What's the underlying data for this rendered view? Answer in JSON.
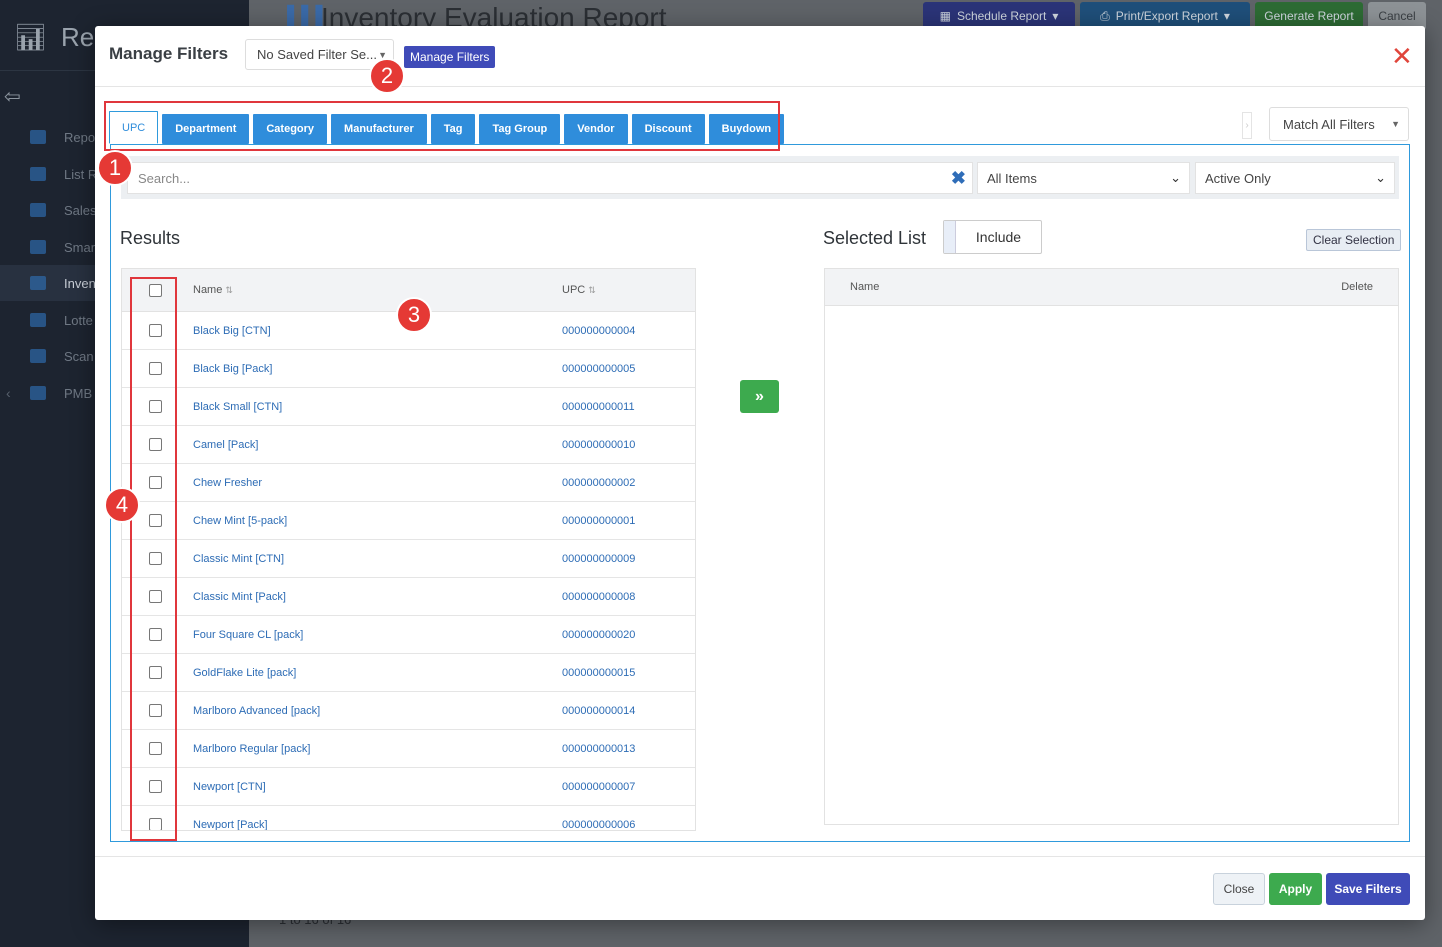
{
  "background_app": {
    "brand_text": "Rep",
    "sidebar_items": [
      {
        "label": "Repo",
        "active": false
      },
      {
        "label": "List R",
        "active": false
      },
      {
        "label": "Sales",
        "active": false
      },
      {
        "label": "Smar",
        "active": false
      },
      {
        "label": "Inven",
        "active": true
      },
      {
        "label": "Lotte",
        "active": false
      },
      {
        "label": "Scan",
        "active": false
      },
      {
        "label": "PMB",
        "active": false
      }
    ],
    "report_title": "Inventory Evaluation Report",
    "top_buttons": {
      "schedule": "Schedule Report",
      "print": "Print/Export Report",
      "generate": "Generate Report",
      "cancel": "Cancel"
    },
    "footer_count": "1 to 16 of 16"
  },
  "modal": {
    "title": "Manage Filters",
    "saved_filter_value": "No Saved Filter Se...",
    "manage_filters_label": "Manage Filters",
    "close_icon": "close-x",
    "tabs": [
      "UPC",
      "Department",
      "Category",
      "Manufacturer",
      "Tag",
      "Tag Group",
      "Vendor",
      "Discount",
      "Buydown"
    ],
    "active_tab": "UPC",
    "match_select_value": "Match All Filters",
    "search": {
      "placeholder": "Search...",
      "items_filter": "All Items",
      "status_filter": "Active Only"
    },
    "results": {
      "title": "Results",
      "col_name": "Name",
      "col_upc": "UPC",
      "rows": [
        {
          "name": "Black Big [CTN]",
          "upc": "000000000004"
        },
        {
          "name": "Black Big [Pack]",
          "upc": "000000000005"
        },
        {
          "name": "Black Small [CTN]",
          "upc": "000000000011"
        },
        {
          "name": "Camel [Pack]",
          "upc": "000000000010"
        },
        {
          "name": "Chew Fresher",
          "upc": "000000000002"
        },
        {
          "name": "Chew Mint [5-pack]",
          "upc": "000000000001"
        },
        {
          "name": "Classic Mint [CTN]",
          "upc": "000000000009"
        },
        {
          "name": "Classic Mint [Pack]",
          "upc": "000000000008"
        },
        {
          "name": "Four Square CL [pack]",
          "upc": "000000000020"
        },
        {
          "name": "GoldFlake Lite [pack]",
          "upc": "000000000015"
        },
        {
          "name": "Marlboro Advanced [pack]",
          "upc": "000000000014"
        },
        {
          "name": "Marlboro Regular [pack]",
          "upc": "000000000013"
        },
        {
          "name": "Newport [CTN]",
          "upc": "000000000007"
        },
        {
          "name": "Newport [Pack]",
          "upc": "000000000006"
        }
      ]
    },
    "move_icon": "double-chevron-right",
    "selected": {
      "title": "Selected List",
      "include_label": "Include",
      "clear_label": "Clear Selection",
      "col_name": "Name",
      "col_delete": "Delete"
    },
    "footer": {
      "close": "Close",
      "apply": "Apply",
      "save": "Save Filters"
    }
  },
  "annotations": [
    "1",
    "2",
    "3",
    "4"
  ],
  "colors": {
    "tab_blue": "#2f8ddb",
    "link_blue": "#2d6cb5",
    "apply_green": "#3daa4e",
    "save_indigo": "#3f4bb8",
    "annotation_red": "#e53935"
  }
}
